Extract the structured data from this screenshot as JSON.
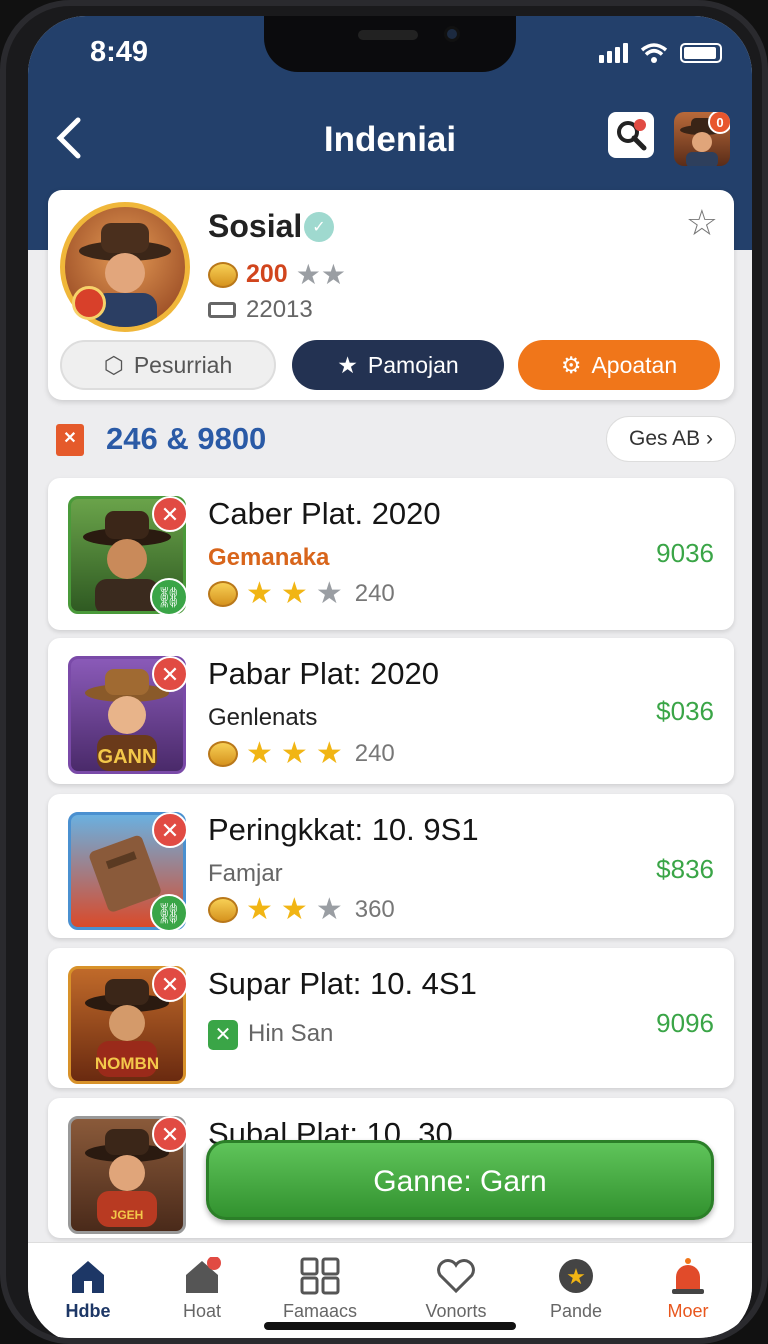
{
  "status_bar": {
    "time": "8:49"
  },
  "header": {
    "title": "Indeniai",
    "notification_count": "0"
  },
  "profile": {
    "name": "Sosial",
    "coins": "200",
    "id_number": "22013",
    "buttons": [
      {
        "label": "Pesurriah"
      },
      {
        "label": "Pamojan"
      },
      {
        "label": "Apoatan"
      }
    ]
  },
  "section": {
    "title": "246 & 9800",
    "see_all": "Ges AB"
  },
  "games": [
    {
      "title": "Caber Plat. 2020",
      "subtitle": "Gemanaka",
      "rating_count": "240",
      "price": "9036",
      "stars_filled": 2,
      "subtitle_color": "#d8651b"
    },
    {
      "title": "Pabar Plat: 2020",
      "subtitle": "Genlenats",
      "rating_count": "240",
      "price": "$036",
      "stars_filled": 3,
      "subtitle_color": "#222222"
    },
    {
      "title": "Peringkkat: 10. 9S1",
      "subtitle": "Famjar",
      "rating_count": "360",
      "price": "$836",
      "stars_filled": 2,
      "subtitle_color": "#666666"
    },
    {
      "title": "Supar Plat: 10. 4S1",
      "subtitle": "Hin San",
      "rating_count": "",
      "price": "9096",
      "stars_filled": 0,
      "subtitle_color": "#666666"
    },
    {
      "title": "Subal Plat: 10. 30",
      "subtitle": "",
      "rating_count": "",
      "price": "",
      "stars_filled": 0,
      "subtitle_color": "#666666"
    }
  ],
  "thumb_labels": [
    "GANN",
    "NOMBN",
    "JGEH"
  ],
  "play_button": {
    "label": "Ganne: Garn"
  },
  "tabs": [
    {
      "label": "Hdbe"
    },
    {
      "label": "Hoat"
    },
    {
      "label": "Famaacs"
    },
    {
      "label": "Vonorts"
    },
    {
      "label": "Pande"
    },
    {
      "label": "Moer"
    }
  ],
  "colors": {
    "header": "#23406b",
    "accent_orange": "#f0761a",
    "price_green": "#3aa547",
    "active_tab": "#1d3766"
  }
}
